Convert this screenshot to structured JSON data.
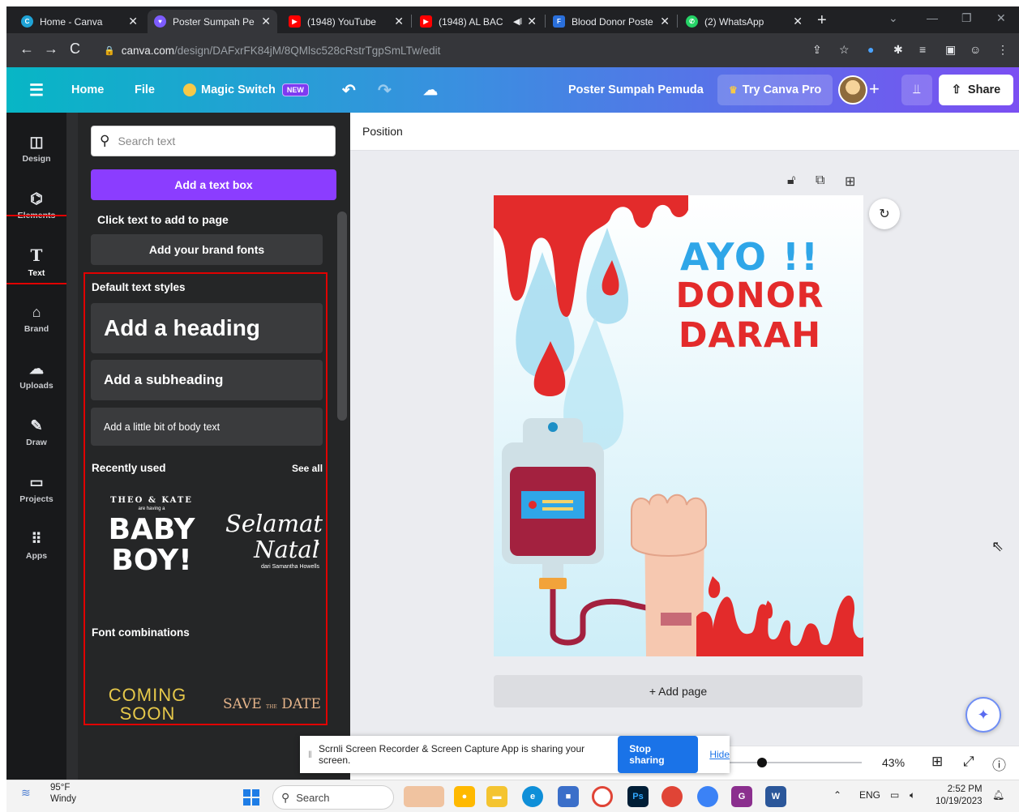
{
  "browser": {
    "tabs": [
      {
        "title": "Home - Canva"
      },
      {
        "title": "Poster Sumpah Pe"
      },
      {
        "title": "(1948) YouTube"
      },
      {
        "title": "(1948) AL BAC"
      },
      {
        "title": "Blood Donor Poste"
      },
      {
        "title": "(2) WhatsApp"
      }
    ],
    "url_domain": "canva.com",
    "url_path": "/design/DAFxrFK84jM/8QMlsc528cRstrTgpSmLTw/edit"
  },
  "header": {
    "home": "Home",
    "file": "File",
    "magic_switch": "Magic Switch",
    "new_badge": "NEW",
    "design_title": "Poster Sumpah Pemuda",
    "try_pro": "Try Canva Pro",
    "share": "Share"
  },
  "rail": {
    "items": [
      {
        "label": "Design",
        "icon": "layout-icon"
      },
      {
        "label": "Elements",
        "icon": "shapes-icon"
      },
      {
        "label": "Text",
        "icon": "text-icon"
      },
      {
        "label": "Brand",
        "icon": "brand-icon"
      },
      {
        "label": "Uploads",
        "icon": "upload-cloud-icon"
      },
      {
        "label": "Draw",
        "icon": "pen-icon"
      },
      {
        "label": "Projects",
        "icon": "folder-icon"
      },
      {
        "label": "Apps",
        "icon": "apps-grid-icon"
      }
    ],
    "active": "Text"
  },
  "panel": {
    "search_placeholder": "Search text",
    "add_text_box": "Add a text box",
    "click_to_add": "Click text to add to page",
    "brand_fonts": "Add your brand fonts",
    "default_styles": "Default text styles",
    "heading": "Add a heading",
    "subheading": "Add a subheading",
    "body": "Add a little bit of body text",
    "recently_used": "Recently used",
    "see_all": "See all",
    "recent1": {
      "top": "THEO & KATE",
      "small": "are having a",
      "line1": "BABY",
      "line2": "BOY!"
    },
    "recent2": {
      "line1": "Selamat",
      "line2": "Natal",
      "small": "dari Samantha Howells"
    },
    "font_combinations": "Font combinations",
    "combo1": {
      "line1": "COMING",
      "line2": "SOON"
    },
    "combo2": {
      "pre": "SAVE",
      "mid": "THE",
      "post": "DATE"
    }
  },
  "workspace": {
    "position_label": "Position",
    "poster": {
      "line1": "AYO !!",
      "line2": "DONOR",
      "line3": "DARAH"
    },
    "add_page": "+ Add page",
    "zoom": "43%"
  },
  "sharebar": {
    "message": "Scrnli Screen Recorder & Screen Capture App is sharing your screen.",
    "stop": "Stop sharing",
    "hide": "Hide"
  },
  "taskbar": {
    "temp": "95°F",
    "weather": "Windy",
    "search": "Search",
    "lang": "ENG",
    "time": "2:52 PM",
    "date": "10/19/2023"
  },
  "colors": {
    "accent_purple": "#8b3dff",
    "header_gradient_start": "#07b6c5",
    "header_gradient_end": "#7b4ff2",
    "poster_blue": "#2fa6e8",
    "poster_red": "#e32b2b",
    "highlight_red": "#e10000"
  }
}
